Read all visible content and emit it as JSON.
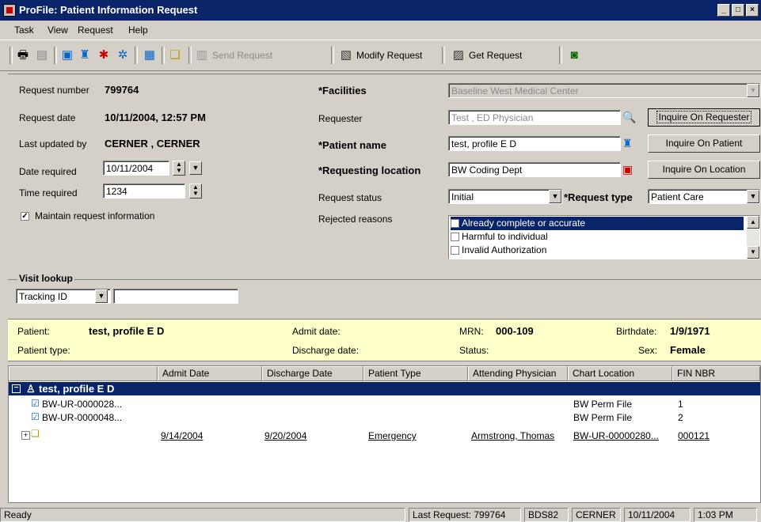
{
  "window": {
    "title": "ProFile: Patient Information Request"
  },
  "menu": [
    "Task",
    "View",
    "Request",
    "Help"
  ],
  "toolbar": {
    "send_request": "Send Request",
    "modify_request": "Modify Request",
    "get_request": "Get Request"
  },
  "request": {
    "number_label": "Request number",
    "number": "799764",
    "date_label": "Request date",
    "date": "10/11/2004, 12:57 PM",
    "updated_label": "Last updated by",
    "updated_by": "CERNER , CERNER",
    "date_required_label": "Date required",
    "date_required": "10/11/2004",
    "time_required_label": "Time required",
    "time_required": "1234",
    "maintain_label": "Maintain request information",
    "maintain_checked": true
  },
  "right": {
    "facilities_label": "*Facilities",
    "facilities": "Baseline West Medical Center",
    "requester_label": "Requester",
    "requester": "Test , ED Physician",
    "patient_name_label": "*Patient name",
    "patient_name": "test, profile E D",
    "location_label": "*Requesting location",
    "location": "BW Coding Dept",
    "status_label": "Request status",
    "status": "Initial",
    "type_label": "*Request type",
    "type": "Patient Care",
    "rejected_label": "Rejected reasons",
    "rejected_reasons": [
      "Already complete or accurate",
      "Harmful to individual",
      "Invalid Authorization"
    ],
    "inquire_requester": "Inquire On Requester",
    "inquire_patient": "Inquire On Patient",
    "inquire_location": "Inquire On Location"
  },
  "visit": {
    "label": "Visit lookup",
    "select": "Tracking ID",
    "value": ""
  },
  "banner": {
    "patient_label": "Patient:",
    "patient": "test, profile E D",
    "admit_label": "Admit date:",
    "mrn_label": "MRN:",
    "mrn": "000-109",
    "birth_label": "Birthdate:",
    "birthdate": "1/9/1971",
    "ptype_label": "Patient type:",
    "discharge_label": "Discharge date:",
    "status_label": "Status:",
    "sex_label": "Sex:",
    "sex": "Female"
  },
  "grid": {
    "headers": [
      "Admit Date",
      "Discharge Date",
      "Patient Type",
      "Attending Physician",
      "Chart Location",
      "FIN NBR"
    ],
    "root": "test, profile E D",
    "rows": [
      {
        "name": "BW-UR-0000028...",
        "admit": "",
        "discharge": "",
        "ptype": "",
        "physician": "",
        "chart": "BW Perm File",
        "fin": "1"
      },
      {
        "name": "BW-UR-0000048...",
        "admit": "",
        "discharge": "",
        "ptype": "",
        "physician": "",
        "chart": "BW Perm File",
        "fin": "2"
      },
      {
        "name": "",
        "admit": "9/14/2004",
        "discharge": "9/20/2004",
        "ptype": "Emergency",
        "physician": "Armstrong, Thomas",
        "chart": "BW-UR-00000280...",
        "fin": "000121"
      }
    ]
  },
  "status": {
    "ready": "Ready",
    "last_request": "Last Request: 799764",
    "code": "BDS82",
    "user": "CERNER",
    "date": "10/11/2004",
    "time": "1:03 PM"
  }
}
